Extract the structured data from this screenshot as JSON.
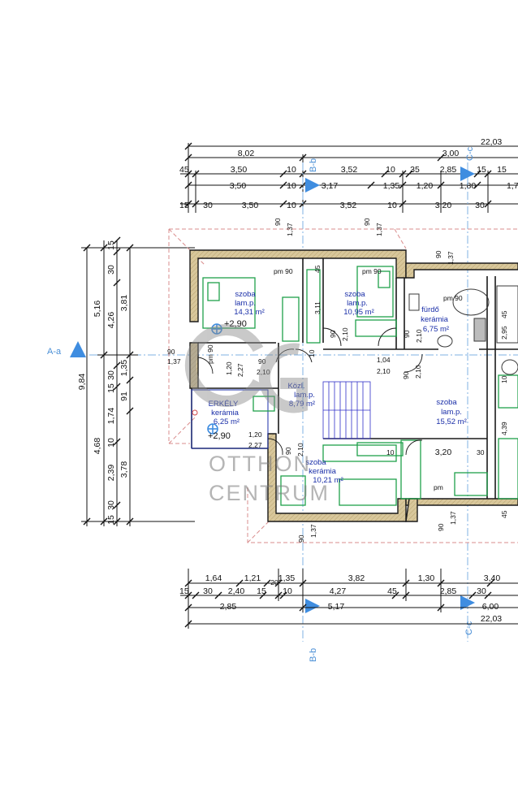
{
  "watermark": {
    "line1": "OTTHON",
    "line2": "CENTRUM"
  },
  "section_marks": {
    "a": "A-a",
    "b_top": "B-b",
    "c_top": "C-c",
    "b_bot": "B-b",
    "c_bot": "C-c"
  },
  "top_dims": {
    "row1": [
      "22,03"
    ],
    "row2": [
      "8,02",
      "3,00"
    ],
    "row3": [
      "45",
      "3,50",
      "10",
      "3,52",
      "10",
      "35",
      "2,85",
      "15",
      "15"
    ],
    "row4": [
      "3,50",
      "10",
      "3,17",
      "1,35",
      "1,20",
      "1,80",
      "1,7"
    ],
    "row5": [
      "15",
      "30",
      "3,50",
      "10",
      "3,52",
      "10",
      "3,20",
      "30"
    ]
  },
  "bottom_dims": {
    "row1": [
      "1,64",
      "1,21",
      "20",
      "1,35",
      "3,82",
      "1,30",
      "3,40"
    ],
    "row2": [
      "15",
      "30",
      "2,40",
      "15",
      "10",
      "4,27",
      "45",
      "2,85",
      "30"
    ],
    "row3": [
      "2,85",
      "5,17",
      "6,00"
    ],
    "row4": [
      "22,03"
    ]
  },
  "left_dims": {
    "outer": [
      "9,84"
    ],
    "mid": [
      "5,16",
      "4,68"
    ],
    "inner": [
      "15",
      "30",
      "4,26",
      "30",
      "15",
      "1,74",
      "10",
      "2,39",
      "30",
      "15"
    ],
    "inner2": [
      "3,81",
      "1,35",
      "91",
      "3,78"
    ]
  },
  "rooms": [
    {
      "name": "szoba",
      "floor": "lam.p.",
      "area": "14,31 m²"
    },
    {
      "name": "szoba",
      "floor": "lam.p.",
      "area": "10,95 m²"
    },
    {
      "name": "fürdő",
      "floor": "kerámia",
      "area": "6,75 m²"
    },
    {
      "name": "Közl.",
      "floor": "lam.p.",
      "area": "8,79 m²"
    },
    {
      "name": "ERKÉLY",
      "floor": "kerámia",
      "area": "6,25 m²"
    },
    {
      "name": "szoba",
      "floor": "lam.p.",
      "area": "15,52 m²"
    },
    {
      "name": "szoba",
      "floor": "kerámia",
      "area": "10,21 m²"
    }
  ],
  "levels": [
    "+2,90",
    "+2,90"
  ],
  "openings": {
    "pm1": "pm 90",
    "pm2": "pm 90",
    "pm3": "pm 90",
    "pm4": "pm",
    "d90": "90",
    "d137": "1,37",
    "d210": "2,10",
    "d104": "1,04",
    "d120": "1,20",
    "d227": "2,27",
    "d311": "3,11",
    "d295": "2,95",
    "d439": "4,39",
    "d10": "10",
    "d45": "45",
    "d320": "3,20"
  },
  "colors": {
    "wall": "#c9b98a",
    "wall_edge": "#1a1a1a",
    "furniture": "#1fa04a",
    "room_text": "#1a2ea8",
    "section": "#4a8fd6",
    "guide": "#d98c8c"
  }
}
